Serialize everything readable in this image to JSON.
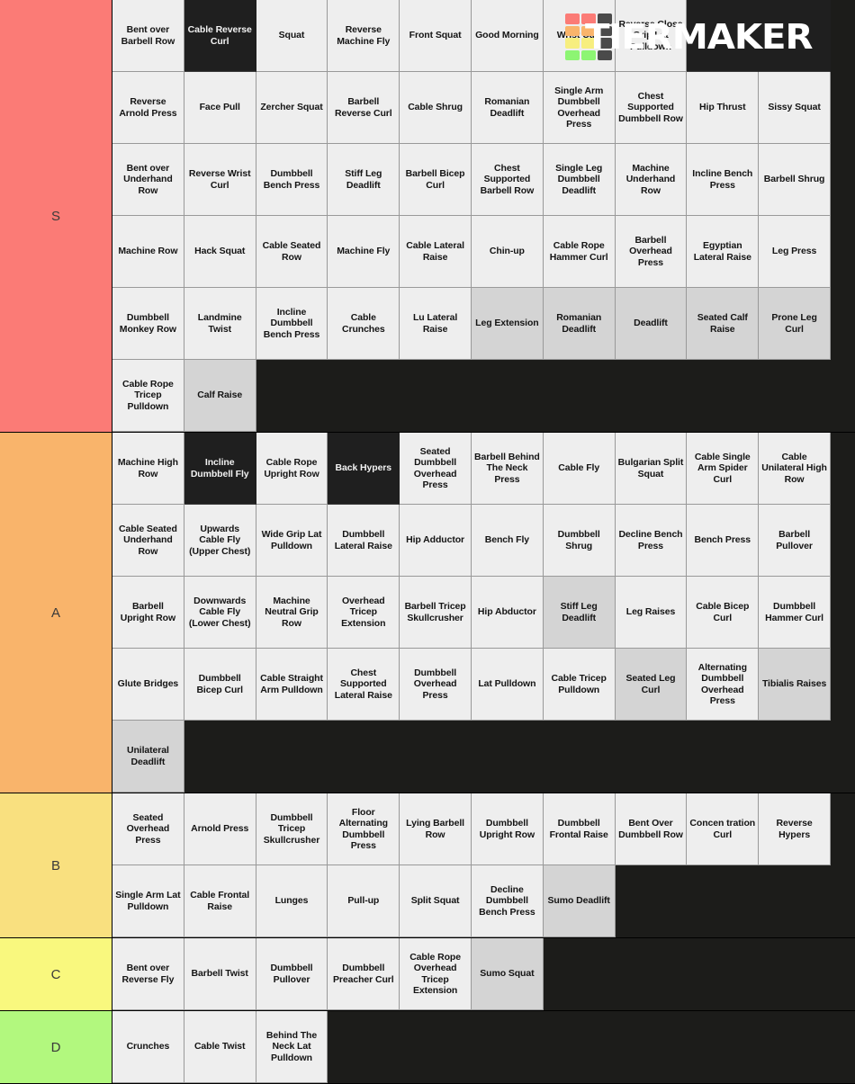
{
  "watermark": {
    "brand": "TIERMAKER",
    "grid_colors": [
      "#fb7b76",
      "#fb7b76",
      "#4a4a4a",
      "#f9b46b",
      "#f9b46b",
      "#4a4a4a",
      "#f7ee7f",
      "#f7ee7f",
      "#4a4a4a",
      "#8df573",
      "#8df573",
      "#4a4a4a"
    ]
  },
  "colors": {
    "S": "#fb7b76",
    "A": "#f9b46b",
    "B": "#f9e07f",
    "C": "#f9f87e",
    "D": "#b2f87e",
    "light_cell": "#eeeeee",
    "gray_cell": "#d4d4d4",
    "dark_cell": "#1f1f1f",
    "board_bg": "#1c1c1a"
  },
  "tiers": [
    {
      "label": "S",
      "color": "#fb7b76",
      "items": [
        {
          "name": "Bent over Barbell Row",
          "style": "light"
        },
        {
          "name": "Cable Reverse Curl",
          "style": "dark"
        },
        {
          "name": "Squat",
          "style": "light"
        },
        {
          "name": "Reverse Machine Fly",
          "style": "light"
        },
        {
          "name": "Front Squat",
          "style": "light"
        },
        {
          "name": "Good Morning",
          "style": "light"
        },
        {
          "name": "Wrist Curl",
          "style": "light"
        },
        {
          "name": "Reverse Close Grip Lat Pulldown",
          "style": "light"
        },
        {
          "name": "",
          "style": "dark"
        },
        {
          "name": "",
          "style": "dark"
        },
        {
          "name": "Reverse Arnold Press",
          "style": "light"
        },
        {
          "name": "Face Pull",
          "style": "light"
        },
        {
          "name": "Zercher Squat",
          "style": "light"
        },
        {
          "name": "Barbell Reverse Curl",
          "style": "light"
        },
        {
          "name": "Cable Shrug",
          "style": "light"
        },
        {
          "name": "Romanian Deadlift",
          "style": "light"
        },
        {
          "name": "Single Arm Dumbbell Overhead Press",
          "style": "light"
        },
        {
          "name": "Chest Supported Dumbbell Row",
          "style": "light"
        },
        {
          "name": "Hip Thrust",
          "style": "light"
        },
        {
          "name": "Sissy Squat",
          "style": "light"
        },
        {
          "name": "Bent over Underhand Row",
          "style": "light"
        },
        {
          "name": "Reverse Wrist Curl",
          "style": "light"
        },
        {
          "name": "Dumbbell Bench Press",
          "style": "light"
        },
        {
          "name": "Stiff Leg Deadlift",
          "style": "light"
        },
        {
          "name": "Barbell Bicep Curl",
          "style": "light"
        },
        {
          "name": "Chest Supported Barbell Row",
          "style": "light"
        },
        {
          "name": "Single Leg Dumbbell Deadlift",
          "style": "light"
        },
        {
          "name": "Machine Underhand Row",
          "style": "light"
        },
        {
          "name": "Incline Bench Press",
          "style": "light"
        },
        {
          "name": "Barbell Shrug",
          "style": "light"
        },
        {
          "name": "Machine Row",
          "style": "light"
        },
        {
          "name": "Hack Squat",
          "style": "light"
        },
        {
          "name": "Cable Seated Row",
          "style": "light"
        },
        {
          "name": "Machine Fly",
          "style": "light"
        },
        {
          "name": "Cable Lateral Raise",
          "style": "light"
        },
        {
          "name": "Chin-up",
          "style": "light"
        },
        {
          "name": "Cable Rope Hammer Curl",
          "style": "light"
        },
        {
          "name": "Barbell Overhead Press",
          "style": "light"
        },
        {
          "name": "Egyptian Lateral Raise",
          "style": "light"
        },
        {
          "name": "Leg Press",
          "style": "light"
        },
        {
          "name": "Dumbbell Monkey Row",
          "style": "light"
        },
        {
          "name": "Landmine Twist",
          "style": "light"
        },
        {
          "name": "Incline Dumbbell Bench Press",
          "style": "light"
        },
        {
          "name": "Cable Crunches",
          "style": "light"
        },
        {
          "name": "Lu Lateral Raise",
          "style": "light"
        },
        {
          "name": "Leg Extension",
          "style": "gray"
        },
        {
          "name": "Romanian Deadlift",
          "style": "gray"
        },
        {
          "name": "Deadlift",
          "style": "gray"
        },
        {
          "name": "Seated Calf Raise",
          "style": "gray"
        },
        {
          "name": "Prone Leg Curl",
          "style": "gray"
        },
        {
          "name": "Cable Rope Tricep Pulldown",
          "style": "light"
        },
        {
          "name": "Calf Raise",
          "style": "gray"
        }
      ]
    },
    {
      "label": "A",
      "color": "#f9b46b",
      "items": [
        {
          "name": "Machine High Row",
          "style": "light"
        },
        {
          "name": "Incline Dumbbell Fly",
          "style": "dark"
        },
        {
          "name": "Cable Rope Upright Row",
          "style": "light"
        },
        {
          "name": "Back Hypers",
          "style": "dark"
        },
        {
          "name": "Seated Dumbbell Overhead Press",
          "style": "light"
        },
        {
          "name": "Barbell Behind The Neck Press",
          "style": "light"
        },
        {
          "name": "Cable Fly",
          "style": "light"
        },
        {
          "name": "Bulgarian Split Squat",
          "style": "light"
        },
        {
          "name": "Cable Single Arm Spider Curl",
          "style": "light"
        },
        {
          "name": "Cable Unilateral High Row",
          "style": "light"
        },
        {
          "name": "Cable Seated Underhand Row",
          "style": "light"
        },
        {
          "name": "Upwards Cable Fly (Upper Chest)",
          "style": "light"
        },
        {
          "name": "Wide Grip Lat Pulldown",
          "style": "light"
        },
        {
          "name": "Dumbbell Lateral Raise",
          "style": "light"
        },
        {
          "name": "Hip Adductor",
          "style": "light"
        },
        {
          "name": "Bench Fly",
          "style": "light"
        },
        {
          "name": "Dumbbell Shrug",
          "style": "light"
        },
        {
          "name": "Decline Bench Press",
          "style": "light"
        },
        {
          "name": "Bench Press",
          "style": "light"
        },
        {
          "name": "Barbell Pullover",
          "style": "light"
        },
        {
          "name": "Barbell Upright Row",
          "style": "light"
        },
        {
          "name": "Downwards Cable Fly (Lower Chest)",
          "style": "light"
        },
        {
          "name": "Machine Neutral Grip Row",
          "style": "light"
        },
        {
          "name": "Overhead Tricep Extension",
          "style": "light"
        },
        {
          "name": "Barbell Tricep Skullcrusher",
          "style": "light"
        },
        {
          "name": "Hip Abductor",
          "style": "light"
        },
        {
          "name": "Stiff Leg Deadlift",
          "style": "gray"
        },
        {
          "name": "Leg Raises",
          "style": "light"
        },
        {
          "name": "Cable Bicep Curl",
          "style": "light"
        },
        {
          "name": "Dumbbell Hammer Curl",
          "style": "light"
        },
        {
          "name": "Glute Bridges",
          "style": "light"
        },
        {
          "name": "Dumbbell Bicep Curl",
          "style": "light"
        },
        {
          "name": "Cable Straight Arm Pulldown",
          "style": "light"
        },
        {
          "name": "Chest Supported Lateral Raise",
          "style": "light"
        },
        {
          "name": "Dumbbell Overhead Press",
          "style": "light"
        },
        {
          "name": "Lat Pulldown",
          "style": "light"
        },
        {
          "name": "Cable Tricep Pulldown",
          "style": "light"
        },
        {
          "name": "Seated Leg Curl",
          "style": "gray"
        },
        {
          "name": "Alternating Dumbbell Overhead Press",
          "style": "light"
        },
        {
          "name": "Tibialis Raises",
          "style": "gray"
        },
        {
          "name": "Unilateral Deadlift",
          "style": "gray"
        }
      ]
    },
    {
      "label": "B",
      "color": "#f9e07f",
      "items": [
        {
          "name": "Seated Overhead Press",
          "style": "light"
        },
        {
          "name": "Arnold Press",
          "style": "light"
        },
        {
          "name": "Dumbbell Tricep Skullcrusher",
          "style": "light"
        },
        {
          "name": "Floor Alternating Dumbbell Press",
          "style": "light"
        },
        {
          "name": "Lying Barbell Row",
          "style": "light"
        },
        {
          "name": "Dumbbell Upright Row",
          "style": "light"
        },
        {
          "name": "Dumbbell Frontal Raise",
          "style": "light"
        },
        {
          "name": "Bent Over Dumbbell Row",
          "style": "light"
        },
        {
          "name": "Concen tration Curl",
          "style": "light"
        },
        {
          "name": "Reverse Hypers",
          "style": "light"
        },
        {
          "name": "Single Arm Lat Pulldown",
          "style": "light"
        },
        {
          "name": "Cable Frontal Raise",
          "style": "light"
        },
        {
          "name": "Lunges",
          "style": "light"
        },
        {
          "name": "Pull-up",
          "style": "light"
        },
        {
          "name": "Split Squat",
          "style": "light"
        },
        {
          "name": "Decline Dumbbell Bench Press",
          "style": "light"
        },
        {
          "name": "Sumo Deadlift",
          "style": "gray"
        }
      ]
    },
    {
      "label": "C",
      "color": "#f9f87e",
      "items": [
        {
          "name": "Bent over Reverse Fly",
          "style": "light"
        },
        {
          "name": "Barbell Twist",
          "style": "light"
        },
        {
          "name": "Dumbbell Pullover",
          "style": "light"
        },
        {
          "name": "Dumbbell Preacher Curl",
          "style": "light"
        },
        {
          "name": "Cable Rope Overhead Tricep Extension",
          "style": "light"
        },
        {
          "name": "Sumo Squat",
          "style": "gray"
        }
      ]
    },
    {
      "label": "D",
      "color": "#b2f87e",
      "items": [
        {
          "name": "Crunches",
          "style": "light"
        },
        {
          "name": "Cable Twist",
          "style": "light"
        },
        {
          "name": "Behind The Neck Lat Pulldown",
          "style": "light"
        }
      ]
    }
  ]
}
